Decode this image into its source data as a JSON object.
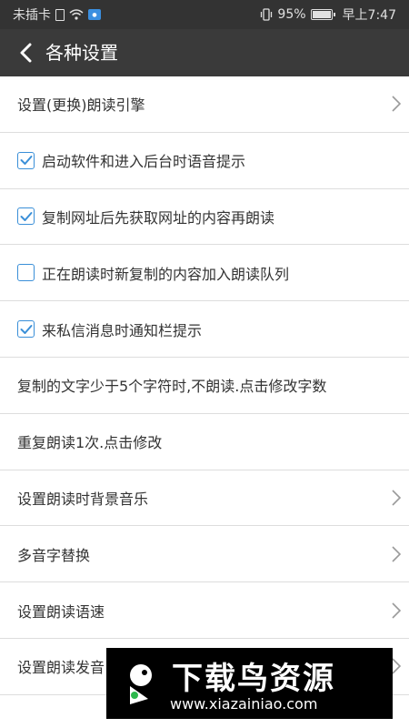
{
  "status_bar": {
    "carrier": "未插卡",
    "battery": "95%",
    "time": "早上7:47"
  },
  "toolbar": {
    "title": "各种设置"
  },
  "settings": [
    {
      "label": "设置(更换)朗读引擎",
      "type": "nav"
    },
    {
      "label": "启动软件和进入后台时语音提示",
      "type": "checkbox",
      "checked": true
    },
    {
      "label": "复制网址后先获取网址的内容再朗读",
      "type": "checkbox",
      "checked": true
    },
    {
      "label": "正在朗读时新复制的内容加入朗读队列",
      "type": "checkbox",
      "checked": false
    },
    {
      "label": "来私信消息时通知栏提示",
      "type": "checkbox",
      "checked": true
    },
    {
      "label": "复制的文字少于5个字符时,不朗读.点击修改字数",
      "type": "text"
    },
    {
      "label": "重复朗读1次.点击修改",
      "type": "text"
    },
    {
      "label": "设置朗读时背景音乐",
      "type": "nav"
    },
    {
      "label": "多音字替换",
      "type": "nav"
    },
    {
      "label": "设置朗读语速",
      "type": "nav"
    },
    {
      "label": "设置朗读发音",
      "type": "nav"
    }
  ],
  "watermark": {
    "name": "下载鸟资源",
    "url": "www.xiazainiao.com"
  },
  "colors": {
    "status_bar_bg": "#333333",
    "toolbar_bg": "#3a3a3a",
    "checkbox_accent": "#3a8fd8",
    "divider": "#dddddd"
  }
}
